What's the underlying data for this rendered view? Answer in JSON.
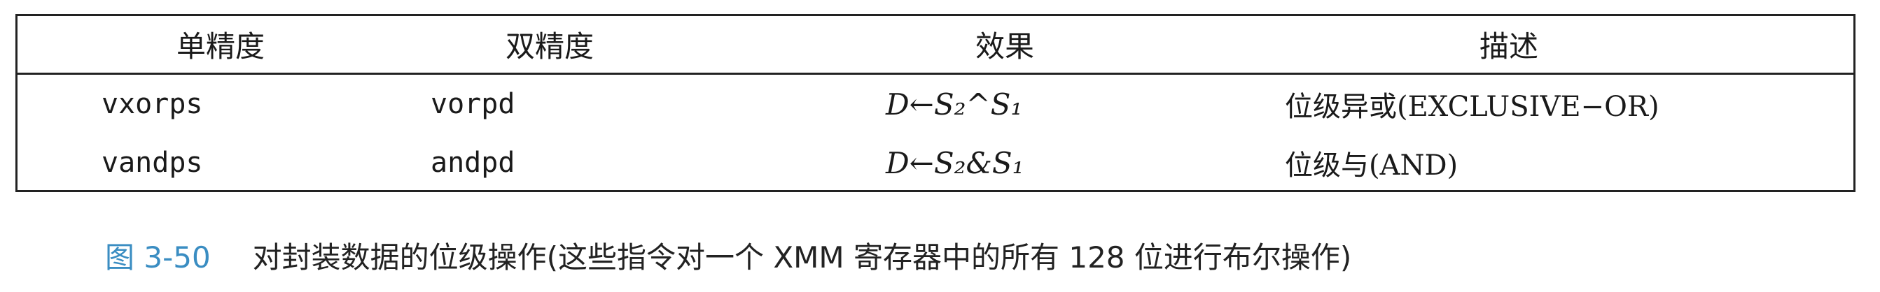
{
  "table": {
    "headers": [
      "单精度",
      "双精度",
      "效果",
      "描述"
    ],
    "rows": [
      {
        "single": "vxorps",
        "double": "vorpd",
        "effect": "D←S₂^S₁",
        "description": "位级异或(EXCLUSIVE−OR)"
      },
      {
        "single": "vandps",
        "double": "andpd",
        "effect": "D←S₂&S₁",
        "description": "位级与(AND)"
      }
    ]
  },
  "caption": {
    "label": "图 3-50",
    "text": "对封装数据的位级操作(这些指令对一个 XMM 寄存器中的所有 128 位进行布尔操作)"
  },
  "colors": {
    "caption_label": "#3a8dc2",
    "border": "#222222"
  }
}
